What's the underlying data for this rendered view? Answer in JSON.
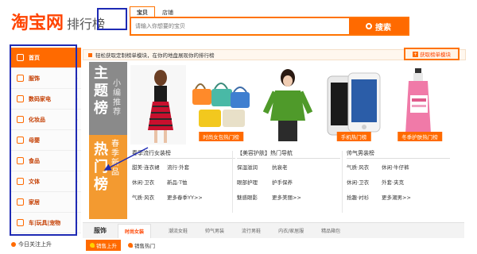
{
  "header": {
    "logo_main": "淘宝网",
    "logo_sub": "排行榜",
    "search_tabs": [
      "宝贝",
      "店铺"
    ],
    "search_placeholder": "请输入你想要的宝贝",
    "search_button": "搜索"
  },
  "sidebar": {
    "items": [
      {
        "label": "首页"
      },
      {
        "label": "服饰"
      },
      {
        "label": "数码家电"
      },
      {
        "label": "化妆品"
      },
      {
        "label": "母婴"
      },
      {
        "label": "食品"
      },
      {
        "label": "文体"
      },
      {
        "label": "家居"
      },
      {
        "label": "车|玩具|宠物"
      }
    ],
    "footer": "今日关注上升"
  },
  "notice": {
    "text": "轻松获取定制榜单模块，在你的地盘展现你的排行榜",
    "custom_button": "获取榜单模块"
  },
  "banners": {
    "theme_big": "主题榜",
    "theme_small": "小编推荐",
    "hot_big": "热门榜",
    "hot_small": "春季新品"
  },
  "products": [
    {
      "caption": ""
    },
    {
      "caption": "时尚女包热门榜"
    },
    {
      "caption": ""
    },
    {
      "caption": "手机热门榜"
    },
    {
      "caption": "冬季护肤热门榜"
    }
  ],
  "categories": [
    {
      "title": "春季流行女装榜",
      "rows": [
        [
          "甜美·连衣裙",
          "流行·外套",
          ""
        ],
        [
          "休闲·卫衣",
          "新品·T恤",
          ""
        ],
        [
          "气质·风衣",
          "更多春季YY>>",
          ""
        ]
      ]
    },
    {
      "title": "【美容护肤】热门导航",
      "rows": [
        [
          "保湿滋润",
          "抗衰老",
          ""
        ],
        [
          "眼部护理",
          "护手保养",
          ""
        ],
        [
          "魅惑眼影",
          "更多美丽>>",
          ""
        ]
      ]
    },
    {
      "title": "帅气男装榜",
      "rows": [
        [
          "气质·风衣",
          "休闲·牛仔裤",
          ""
        ],
        [
          "休闲·卫衣",
          "外套·夹克",
          ""
        ],
        [
          "拾趣·衬衫",
          "更多潮男>>",
          ""
        ]
      ]
    }
  ],
  "bottom": {
    "head": "服饰",
    "tabs": [
      "时尚女装",
      "潮流女鞋",
      "帅气男装",
      "流行男鞋",
      "内衣/家居服",
      "精品箱包"
    ],
    "sales": [
      "销售上升",
      "销售热门"
    ]
  },
  "colors": {
    "accent": "#ff6a00",
    "highlight_box": "#1e2ab4"
  }
}
